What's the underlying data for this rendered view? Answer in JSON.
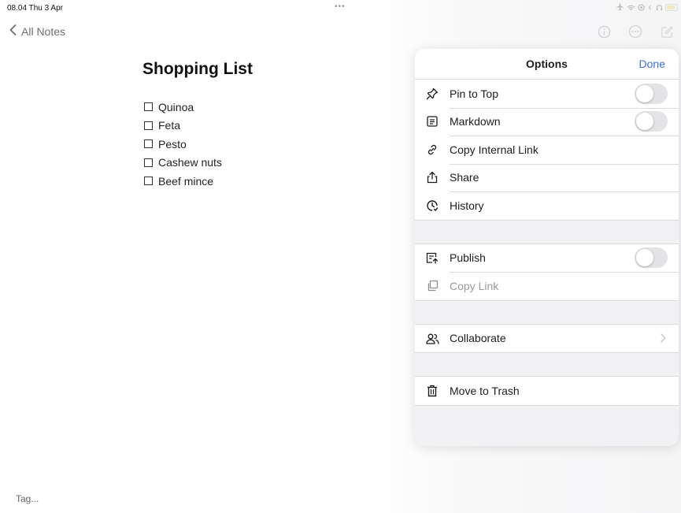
{
  "status_bar": {
    "time": "08.04  Thu 3 Apr",
    "multitask_dots": "•••",
    "battery_color": "#f2c500",
    "icons": [
      "airplane-icon",
      "wifi-icon",
      "focus-icon",
      "moon-icon",
      "headphones-icon",
      "battery-icon"
    ]
  },
  "nav": {
    "back_label": "All Notes",
    "right_icons": [
      "info-icon",
      "more-icon",
      "compose-icon"
    ]
  },
  "note": {
    "title": "Shopping List",
    "items": [
      "Quinoa",
      "Feta",
      "Pesto",
      "Cashew nuts",
      "Beef mince"
    ],
    "tag_placeholder": "Tag..."
  },
  "options": {
    "title": "Options",
    "done_label": "Done",
    "accent_color": "#3a6fd8",
    "groups": [
      [
        {
          "label": "Pin to Top",
          "icon": "pin-icon",
          "control": "toggle",
          "on": false
        },
        {
          "label": "Markdown",
          "icon": "markdown-icon",
          "control": "toggle",
          "on": false
        },
        {
          "label": "Copy Internal Link",
          "icon": "link-icon",
          "control": "none"
        },
        {
          "label": "Share",
          "icon": "share-icon",
          "control": "none"
        },
        {
          "label": "History",
          "icon": "history-icon",
          "control": "none"
        }
      ],
      [
        {
          "label": "Publish",
          "icon": "publish-icon",
          "control": "toggle",
          "on": false
        },
        {
          "label": "Copy Link",
          "icon": "copy-icon",
          "control": "none",
          "disabled": true
        }
      ],
      [
        {
          "label": "Collaborate",
          "icon": "collaborate-icon",
          "control": "chevron"
        }
      ],
      [
        {
          "label": "Move to Trash",
          "icon": "trash-icon",
          "control": "none"
        }
      ]
    ]
  }
}
